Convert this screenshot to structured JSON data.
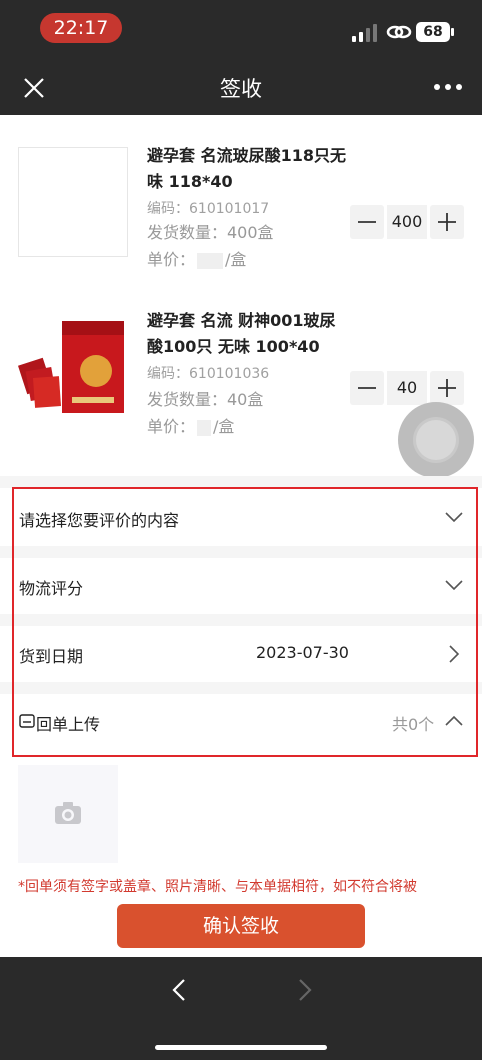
{
  "status_bar": {
    "time": "22:17",
    "battery": "68"
  },
  "nav": {
    "title": "签收"
  },
  "products": [
    {
      "title": "避孕套 名流玻尿酸118只无味 118*40",
      "code": "编码：610101017",
      "qty": "发货数量：400盒",
      "price_prefix": "单价：",
      "price_suffix": "/盒",
      "stepper_value": "400"
    },
    {
      "title": "避孕套 名流 财神001玻尿酸100只 无味 100*40",
      "code": "编码：610101036",
      "qty": "发货数量：40盒",
      "price_prefix": "单价：",
      "price_suffix": "/盒",
      "stepper_value": "40"
    }
  ],
  "form": {
    "review_label": "请选择您要评价的内容",
    "logistics_label": "物流评分",
    "arrival_label": "货到日期",
    "arrival_value": "2023-07-30",
    "receipt_label": "回单上传",
    "receipt_count": "共0个"
  },
  "note": "*回单须有签字或盖章、照片清晰、与本单据相符，如不符合将被",
  "confirm_label": "确认签收",
  "colors": {
    "accent": "#d9512e",
    "highlight_border": "#e0262a",
    "dark_bar": "#2a2a2a"
  }
}
